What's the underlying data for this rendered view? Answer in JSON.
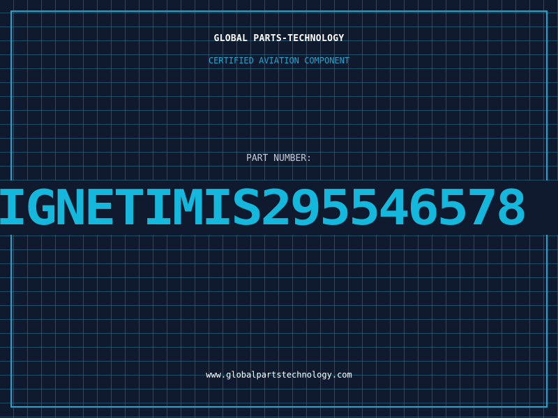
{
  "header": {
    "company": "GLOBAL PARTS-TECHNOLOGY",
    "tagline": "CERTIFIED AVIATION COMPONENT"
  },
  "part": {
    "label": "PART NUMBER:",
    "number": "IGNETIMIS295546578"
  },
  "footer": {
    "website": "www.globalpartstechnology.com"
  },
  "colors": {
    "background": "#101a2e",
    "grid": "#1e5f78",
    "accent": "#1aa6cf",
    "part_number": "#13b8dc",
    "text_primary": "#ffffff",
    "text_muted": "#c3cad6"
  }
}
